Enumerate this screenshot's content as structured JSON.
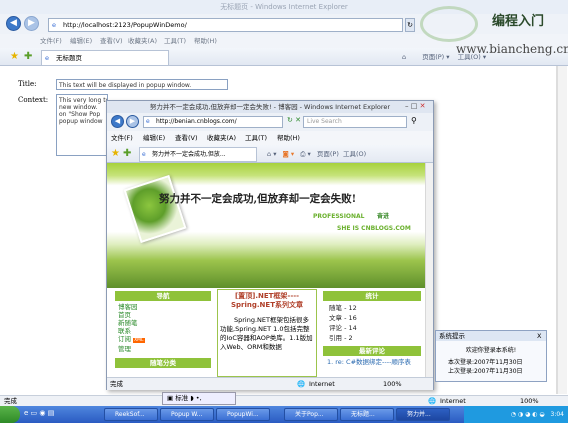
{
  "main": {
    "window_title": "无标题页 - Windows Internet Explorer",
    "address": "http://localhost:2123/PopupWinDemo/",
    "tab_label": "无标题页",
    "title_label": "Title:",
    "title_value": "This text will be displayed in popup window.",
    "context_label": "Context:",
    "context_value": "This very long text will be displayed in\nnew window.\non \"Show Pop\npopup window",
    "status_left": "完成",
    "status_zone": "Internet",
    "zoom": "100%"
  },
  "watermark": {
    "cn": "编程入门",
    "url": "www.biancheng.cn"
  },
  "popup": {
    "title": "努力并不一定会成功,但放弃却一定会失败! - 博客园 - Windows Internet Explorer",
    "address": "http://benian.cnblogs.com/",
    "search_placeholder": "Live Search",
    "menu": [
      "文件(F)",
      "编辑(E)",
      "查看(V)",
      "收藏夹(A)",
      "工具(T)",
      "帮助(H)"
    ],
    "tab_label": "努力并不一定会成功,但放...",
    "toolbar_page": "页面(P)",
    "toolbar_tools": "工具(O)",
    "banner": {
      "headline": "努力并不一定会成功,但放弃却一定会失败!",
      "line2": "PROFESSIONAL",
      "line2b": "奋进",
      "line3": "SHE IS CNBLOGS.COM"
    },
    "nav_head": "导航",
    "nav_links": [
      "博客园",
      "首页",
      "新随笔",
      "联系",
      "订阅",
      "管理"
    ],
    "rss_badge": "XML",
    "nav_head2": "随笔分类",
    "post_title": "[置顶].NET框架----Spring.NET系列文章",
    "post_body": "Spring.NET框架包括很多功能,Spring.NET 1.0包括完整的IoC容器和AOP类库。1.1版加入Web、ORM和数据",
    "stats_head": "统计",
    "stats": [
      {
        "label": "随笔",
        "value": "12"
      },
      {
        "label": "文章",
        "value": "16"
      },
      {
        "label": "评论",
        "value": "14"
      },
      {
        "label": "引用",
        "value": "2"
      }
    ],
    "comments_head": "最新评论",
    "comment1": "1. re: C#数据绑定----顺序表",
    "status_left": "完成",
    "status_zone": "Internet",
    "zoom": "100%"
  },
  "notice": {
    "title": "系统提示",
    "close": "X",
    "welcome": "欢迎你登录本系统!",
    "this_login": "本次登录:2007年11月30日",
    "last_login": "上次登录:2007年11月30日"
  },
  "taskbar": {
    "ime": "标准",
    "buttons": [
      "ReekSof...",
      "Popup W...",
      "PopupWi...",
      "关于Pop...",
      "无标题...",
      "努力并..."
    ],
    "clock": "3:04"
  }
}
